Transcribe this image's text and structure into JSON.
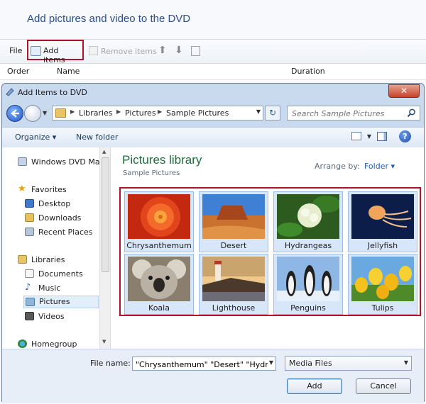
{
  "background_window": {
    "title": "Add pictures and video to the DVD",
    "toolbar": {
      "file": "File",
      "add_items": "Add items",
      "remove_items": "Remove items"
    },
    "columns": {
      "order": "Order",
      "name": "Name",
      "duration": "Duration"
    }
  },
  "dialog": {
    "title": "Add Items to DVD",
    "close_glyph": "✕",
    "breadcrumb": [
      "Libraries",
      "Pictures",
      "Sample Pictures"
    ],
    "search_placeholder": "Search Sample Pictures",
    "commands": {
      "organize": "Organize ▾",
      "new_folder": "New folder"
    },
    "nav": {
      "items": [
        {
          "label": "Windows DVD Mak",
          "icon": "dvd-maker-icon"
        },
        {
          "label": "Favorites",
          "icon": "star-icon"
        },
        {
          "label": "Desktop",
          "icon": "desktop-icon"
        },
        {
          "label": "Downloads",
          "icon": "downloads-icon"
        },
        {
          "label": "Recent Places",
          "icon": "recent-places-icon"
        },
        {
          "label": "Libraries",
          "icon": "libraries-icon"
        },
        {
          "label": "Documents",
          "icon": "documents-icon"
        },
        {
          "label": "Music",
          "icon": "music-icon"
        },
        {
          "label": "Pictures",
          "icon": "pictures-icon"
        },
        {
          "label": "Videos",
          "icon": "videos-icon"
        },
        {
          "label": "Homegroup",
          "icon": "homegroup-icon"
        }
      ],
      "selected": "Pictures"
    },
    "library": {
      "title": "Pictures library",
      "subtitle": "Sample Pictures",
      "arrange_label": "Arrange by:",
      "arrange_value": "Folder ▾"
    },
    "files": [
      {
        "name": "Chrysanthemum"
      },
      {
        "name": "Desert"
      },
      {
        "name": "Hydrangeas"
      },
      {
        "name": "Jellyfish"
      },
      {
        "name": "Koala"
      },
      {
        "name": "Lighthouse"
      },
      {
        "name": "Penguins"
      },
      {
        "name": "Tulips"
      }
    ],
    "file_name_label": "File name:",
    "file_name_value": "\"Chrysanthemum\" \"Desert\" \"Hydrang",
    "file_type": "Media Files",
    "add_button": "Add",
    "cancel_button": "Cancel",
    "help_glyph": "?",
    "refresh_glyph": "↻"
  }
}
